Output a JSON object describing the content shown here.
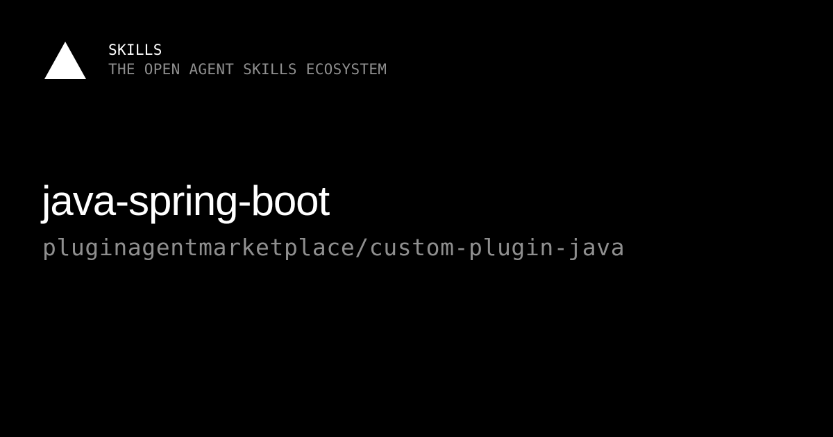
{
  "brand": {
    "name": "SKILLS",
    "tagline": "THE OPEN AGENT SKILLS ECOSYSTEM",
    "logo_icon": "triangle-logo-icon"
  },
  "skill": {
    "title": "java-spring-boot",
    "source": "pluginagentmarketplace/custom-plugin-java"
  },
  "colors": {
    "background": "#000000",
    "primary_text": "#ffffff",
    "muted_text": "#8f8f8f"
  }
}
